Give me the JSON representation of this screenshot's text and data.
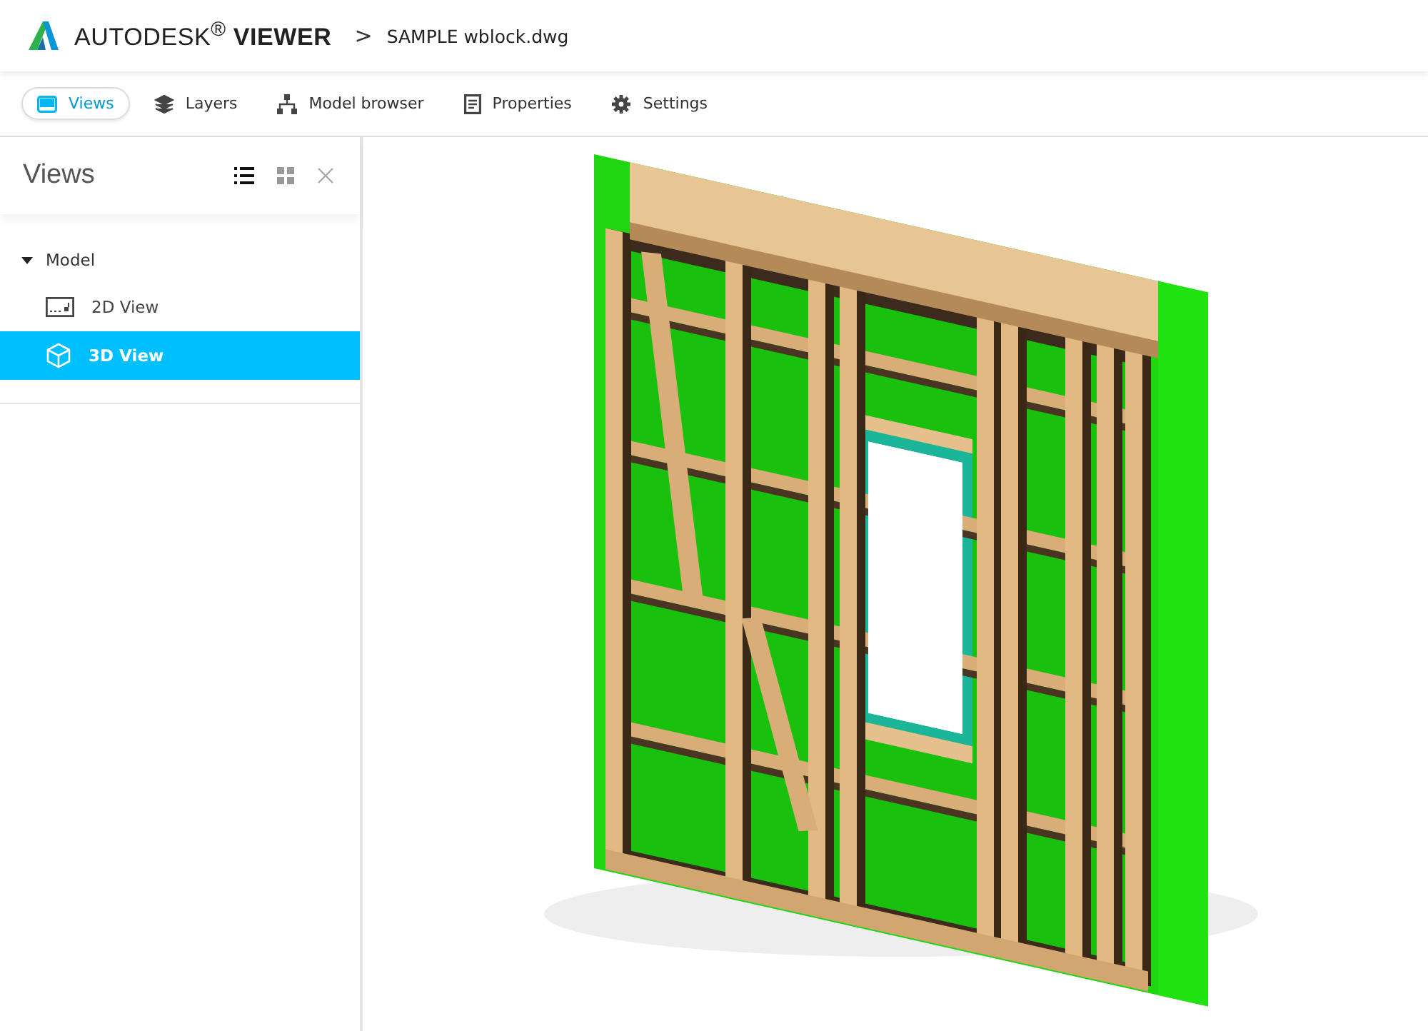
{
  "header": {
    "brand": "AUTODESK$^{®}$",
    "product": "VIEWER",
    "separator": ">",
    "file": "SAMPLE wblock.dwg"
  },
  "tabs": [
    {
      "label": "Views",
      "kind": "monitor",
      "selected": true
    },
    {
      "label": "Layers",
      "kind": "layers",
      "selected": false
    },
    {
      "label": "Model browser",
      "kind": "hierarchy",
      "selected": false
    },
    {
      "label": "Properties",
      "kind": "document",
      "selected": false
    },
    {
      "label": "Settings",
      "kind": "gear",
      "selected": false
    }
  ],
  "panel": {
    "title": "Views",
    "view_modes": [
      {
        "kind": "list",
        "selected": true
      },
      {
        "kind": "grid",
        "selected": false
      }
    ]
  },
  "tree": [
    {
      "label": "Model",
      "expanded": true,
      "children": [
        {
          "label": "2D View",
          "kind": "sheet",
          "selected": false
        },
        {
          "label": "3D View",
          "kind": "cube",
          "selected": true
        }
      ]
    }
  ]
}
